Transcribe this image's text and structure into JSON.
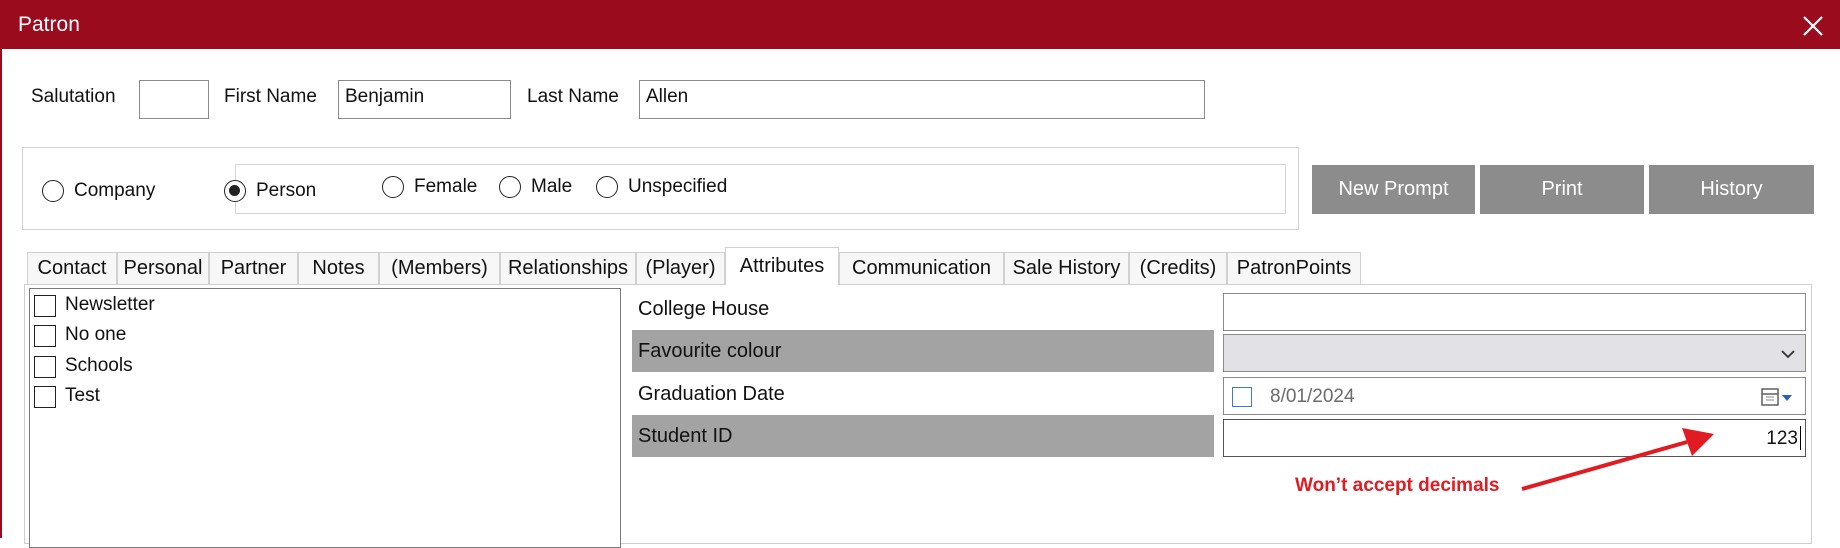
{
  "window": {
    "title": "Patron"
  },
  "name_row": {
    "salutation_label": "Salutation",
    "salutation_value": "",
    "first_name_label": "First Name",
    "first_name_value": "Benjamin",
    "last_name_label": "Last Name",
    "last_name_value": "Allen"
  },
  "type_row": {
    "company_label": "Company",
    "person_label": "Person",
    "selected_type": "Person",
    "female_label": "Female",
    "male_label": "Male",
    "unspecified_label": "Unspecified"
  },
  "actions": {
    "new_prompt": "New Prompt",
    "print": "Print",
    "history": "History"
  },
  "tabs": [
    {
      "label": "Contact"
    },
    {
      "label": "Personal"
    },
    {
      "label": "Partner"
    },
    {
      "label": "Notes"
    },
    {
      "label": "(Members)"
    },
    {
      "label": "Relationships"
    },
    {
      "label": "(Player)"
    },
    {
      "label": "Attributes",
      "active": true
    },
    {
      "label": "Communication"
    },
    {
      "label": "Sale History"
    },
    {
      "label": "(Credits)"
    },
    {
      "label": "PatronPoints"
    }
  ],
  "attributes_list": [
    {
      "label": "Newsletter",
      "checked": false
    },
    {
      "label": "No one",
      "checked": false
    },
    {
      "label": "Schools",
      "checked": false
    },
    {
      "label": "Test",
      "checked": false
    }
  ],
  "attribute_fields": [
    {
      "label": "College House",
      "value": ""
    },
    {
      "label": "Favourite colour",
      "value": ""
    },
    {
      "label": "Graduation Date",
      "value": "8/01/2024"
    },
    {
      "label": "Student ID",
      "value": "123"
    }
  ],
  "annotation": {
    "text": "Won’t accept decimals",
    "color": "#e11b22"
  },
  "colors": {
    "titlebar": "#9a0b1e",
    "button": "#8c8c8c",
    "shaded_row": "#a3a3a3"
  }
}
